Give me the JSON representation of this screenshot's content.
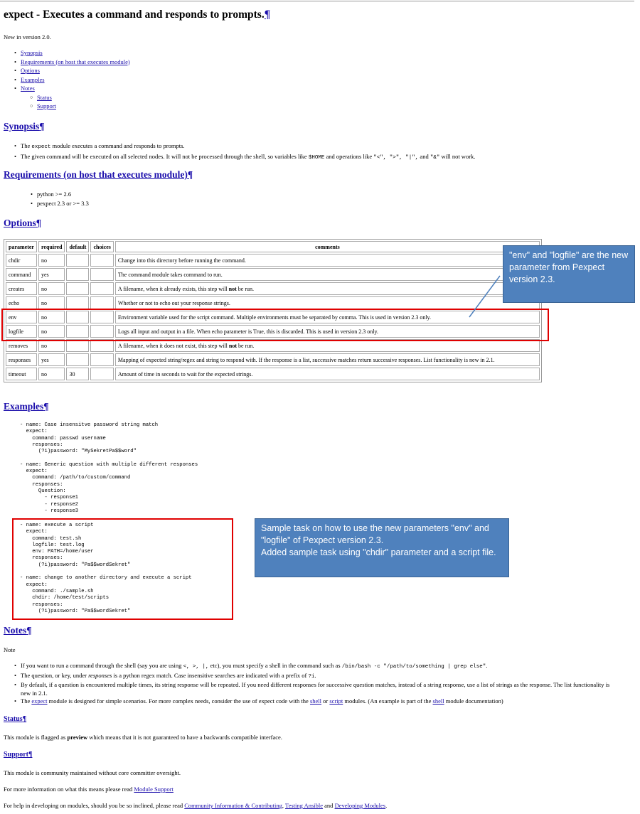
{
  "page_title": "expect - Executes a command and responds to prompts.",
  "pilcrow": "¶",
  "version_note": "New in version 2.0.",
  "toc": [
    "Synopsis",
    "Requirements (on host that executes module)",
    "Options",
    "Examples",
    "Notes"
  ],
  "toc_sub": [
    "Status",
    "Support"
  ],
  "synopsis": {
    "title": "Synopsis",
    "b1_pre": "The ",
    "b1_code": "expect",
    "b1_post": " module executes a command and responds to prompts.",
    "b2_pre": "The given command will be executed on all selected nodes. It will not be processed through the shell, so variables like ",
    "b2_code1": "$HOME",
    "b2_mid": " and operations like ",
    "b2_code2": "\"<\", \">\", \"|\",",
    "b2_and": " and ",
    "b2_code3": "\"&\"",
    "b2_post": " will not work."
  },
  "requirements": {
    "title": "Requirements (on host that executes module)",
    "items": [
      "python >= 2.6",
      "pexpect 2.3 or >= 3.3"
    ]
  },
  "options": {
    "title": "Options",
    "headers": [
      "parameter",
      "required",
      "default",
      "choices",
      "comments"
    ],
    "rows": [
      [
        "chdir",
        "no",
        "",
        "",
        "Change into this directory before running the command."
      ],
      [
        "command",
        "yes",
        "",
        "",
        "The command module takes command to run."
      ],
      [
        "creates",
        "no",
        "",
        "",
        "A filename, when it already exists, this step will ",
        "not",
        " be run."
      ],
      [
        "echo",
        "no",
        "",
        "",
        "Whether or not to echo out your response strings."
      ],
      [
        "env",
        "no",
        "",
        "",
        "Environment variable used for the script command. Multiple environments must be separated by comma. This is used in version 2.3 only."
      ],
      [
        "logfile",
        "no",
        "",
        "",
        "Logs all input and output in a file. When echo parameter is True, this is discarded. This is used in version 2.3 only."
      ],
      [
        "removes",
        "no",
        "",
        "",
        "A filename, when it does not exist, this step will ",
        "not",
        " be run."
      ],
      [
        "responses",
        "yes",
        "",
        "",
        "Mapping of expected string/regex and string to respond with. If the response is a list, successive matches return successive responses. List functionality is new in 2.1."
      ],
      [
        "timeout",
        "no",
        "30",
        "",
        "Amount of time in seconds to wait for the expected strings."
      ]
    ]
  },
  "examples": {
    "title": "Examples",
    "code1": "- name: Case insensitve password string match\n  expect:\n    command: passwd username\n    responses:\n      (?i)password: \"MySekretPa$$word\"\n\n- name: Generic question with multiple different responses\n  expect:\n    command: /path/to/custom/command\n    responses:\n      Question:\n        - response1\n        - response2\n        - response3",
    "code2": "- name: execute a script\n  expect:\n    command: test.sh\n    logfile: test.log\n    env: PATH=/home/user\n    responses:\n      (?i)password: \"Pa$$wordSekret\"\n\n- name: change to another directory and execute a script\n  expect:\n    command: ./sample.sh\n    chdir: /home/test/scripts\n    responses:\n      (?i)password: \"Pa$$wordSekret\""
  },
  "notes": {
    "title": "Notes",
    "label": "Note",
    "n1_pre": "If you want to run a command through the shell (say you are using ",
    "n1_code1": "<, >, |,",
    "n1_mid": " etc), you must specify a shell in the command such as ",
    "n1_code2": "/bin/bash -c \"/path/to/something | grep else\"",
    "n1_post": ".",
    "n2_pre": "The question, or key, under ",
    "n2_em": "responses",
    "n2_mid": " is a python regex match. Case insensitive searches are indicated with a prefix of ",
    "n2_code": "?i",
    "n2_post": ".",
    "n3": "By default, if a question is encountered multiple times, its string response will be repeated. If you need different responses for successive question matches, instead of a string response, use a list of strings as the response. The list functionality is new in 2.1.",
    "n4_pre": "The ",
    "n4_link1": "expect",
    "n4_mid1": " module is designed for simple scenarios. For more complex needs, consider the use of expect code with the ",
    "n4_link2": "shell",
    "n4_or": " or ",
    "n4_link3": "script",
    "n4_mid2": " modules. (An example is part of the ",
    "n4_link4": "shell",
    "n4_post": " module documentation)"
  },
  "status": {
    "title": "Status",
    "pre": "This module is flagged as ",
    "bold": "preview",
    "post": " which means that it is not guaranteed to have a backwards compatible interface."
  },
  "support": {
    "title": "Support",
    "p1": "This module is community maintained without core committer oversight.",
    "p2_pre": "For more information on what this means please read ",
    "p2_link": "Module Support",
    "p3_pre": "For help in developing on modules, should you be so inclined, please read ",
    "p3_link1": "Community Information & Contributing",
    "p3_sep": ", ",
    "p3_link2": "Testing Ansible",
    "p3_and": " and ",
    "p3_link3": "Developing Modules",
    "p3_post": "."
  },
  "callout1": "\"env\" and \"logfile\" are the new parameter from Pexpect version 2.3.",
  "callout2": "Sample task on how to use the new parameters \"env\" and \"logfile\" of Pexpect version 2.3.\nAdded sample  task using \"chdir\" parameter and a script file.",
  "colors": {
    "link": "#1a0dab",
    "highlight_box": "#e00000",
    "callout_bg": "#4f81bd"
  }
}
